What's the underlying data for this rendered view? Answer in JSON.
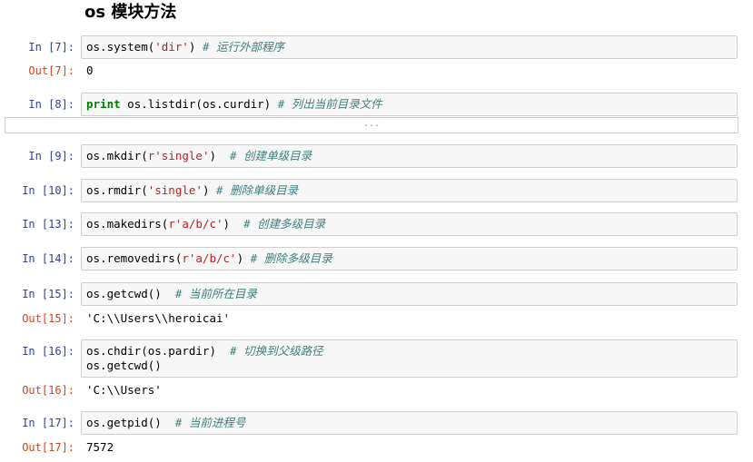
{
  "heading": "os 模块方法",
  "collapsed_marker": "...",
  "cells": [
    {
      "in_prompt": "In [7]:",
      "code": {
        "plain1": "os.system(",
        "str": "'dir'",
        "plain2": ") ",
        "comment": "# 运行外部程序"
      },
      "out_prompt": "Out[7]:",
      "output": "0"
    },
    {
      "in_prompt": "In [8]:",
      "code": {
        "kw": "print",
        "plain1": " os.listdir(os.curdir) ",
        "comment": "# 列出当前目录文件"
      }
    },
    {
      "in_prompt": "In [9]:",
      "code": {
        "plain1": "os.mkdir(",
        "str": "r'single'",
        "plain2": ")  ",
        "comment": "# 创建单级目录"
      }
    },
    {
      "in_prompt": "In [10]:",
      "code": {
        "plain1": "os.rmdir(",
        "str": "'single'",
        "plain2": ") ",
        "comment": "# 删除单级目录"
      }
    },
    {
      "in_prompt": "In [13]:",
      "code": {
        "plain1": "os.makedirs(",
        "str": "r'a/b/c'",
        "plain2": ")  ",
        "comment": "# 创建多级目录"
      }
    },
    {
      "in_prompt": "In [14]:",
      "code": {
        "plain1": "os.removedirs(",
        "str": "r'a/b/c'",
        "plain2": ") ",
        "comment": "# 删除多级目录"
      }
    },
    {
      "in_prompt": "In [15]:",
      "code": {
        "plain1": "os.getcwd()  ",
        "comment": "# 当前所在目录"
      },
      "out_prompt": "Out[15]:",
      "output": "'C:\\\\Users\\\\heroicai'"
    },
    {
      "in_prompt": "In [16]:",
      "code": {
        "plain1": "os.chdir(os.pardir)  ",
        "comment": "# 切换到父级路径",
        "line2": "os.getcwd()"
      },
      "out_prompt": "Out[16]:",
      "output": "'C:\\\\Users'"
    },
    {
      "in_prompt": "In [17]:",
      "code": {
        "plain1": "os.getpid()  ",
        "comment": "# 当前进程号"
      },
      "out_prompt": "Out[17]:",
      "output": "7572"
    }
  ]
}
